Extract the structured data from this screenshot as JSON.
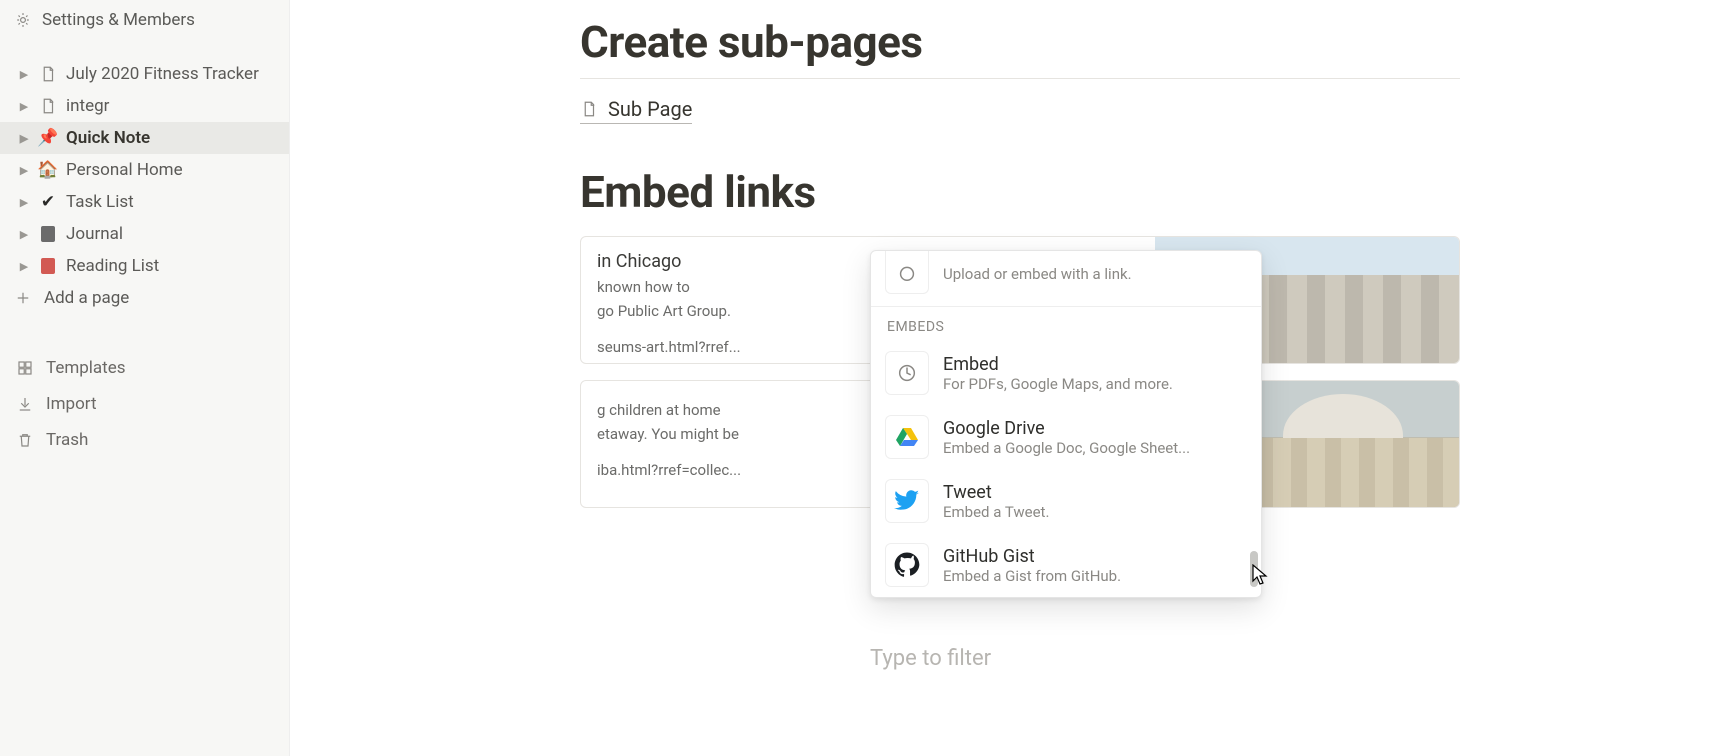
{
  "sidebar": {
    "settings_label": "Settings & Members",
    "pages": [
      {
        "label": "July 2020 Fitness Tracker",
        "icon": "doc"
      },
      {
        "label": "integr",
        "icon": "doc"
      },
      {
        "label": "Quick Note",
        "icon": "pin",
        "active": true
      },
      {
        "label": "Personal Home",
        "icon": "home"
      },
      {
        "label": "Task List",
        "icon": "check"
      },
      {
        "label": "Journal",
        "icon": "book-brown"
      },
      {
        "label": "Reading List",
        "icon": "book-red"
      }
    ],
    "add_page_label": "Add a page",
    "utilities": [
      {
        "label": "Templates",
        "icon": "templates"
      },
      {
        "label": "Import",
        "icon": "import"
      },
      {
        "label": "Trash",
        "icon": "trash"
      }
    ]
  },
  "main": {
    "heading_create": "Create sub-pages",
    "subpage_label": "Sub Page",
    "heading_embed": "Embed links",
    "bookmarks": [
      {
        "title_tail": "in Chicago",
        "desc_tail": "known how to",
        "desc_tail2": "go Public Art Group.",
        "url_tail": "seums-art.html?rref..."
      },
      {
        "title_tail": "",
        "desc_tail": "g children at home",
        "desc_tail2": "etaway. You might be",
        "url_tail": "iba.html?rref=collec..."
      }
    ],
    "filter_placeholder": "Type to filter"
  },
  "popup": {
    "partial_desc": "Upload or embed with a link.",
    "section_label": "EMBEDS",
    "items": [
      {
        "title": "Embed",
        "desc": "For PDFs, Google Maps, and more.",
        "icon": "embed"
      },
      {
        "title": "Google Drive",
        "desc": "Embed a Google Doc, Google Sheet...",
        "icon": "gdrive"
      },
      {
        "title": "Tweet",
        "desc": "Embed a Tweet.",
        "icon": "twitter"
      },
      {
        "title": "GitHub Gist",
        "desc": "Embed a Gist from GitHub.",
        "icon": "github"
      }
    ]
  }
}
